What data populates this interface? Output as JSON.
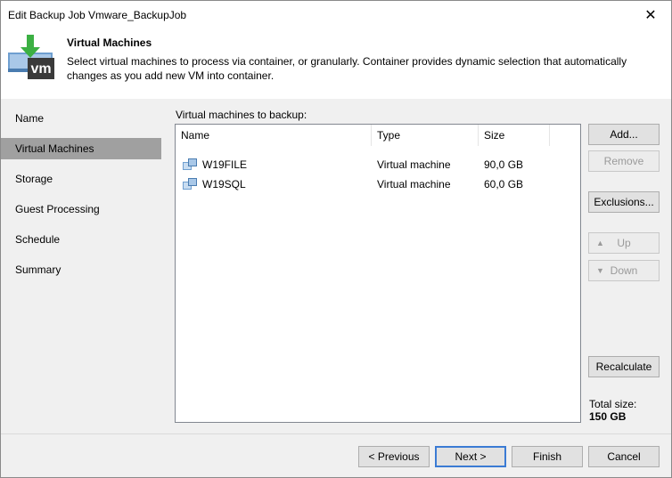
{
  "window": {
    "title": "Edit Backup Job Vmware_BackupJob",
    "close_glyph": "✕"
  },
  "header": {
    "title": "Virtual Machines",
    "description": "Select virtual machines to process via container, or granularly. Container provides dynamic selection that automatically changes as you add new VM into container.",
    "logo_text": "vm",
    "logo_icon": "vm-download-icon"
  },
  "nav": {
    "items": [
      {
        "label": "Name",
        "active": false
      },
      {
        "label": "Virtual Machines",
        "active": true
      },
      {
        "label": "Storage",
        "active": false
      },
      {
        "label": "Guest Processing",
        "active": false
      },
      {
        "label": "Schedule",
        "active": false
      },
      {
        "label": "Summary",
        "active": false
      }
    ]
  },
  "vm_list": {
    "label": "Virtual machines to backup:",
    "columns": [
      "Name",
      "Type",
      "Size"
    ],
    "rows": [
      {
        "name": "W19FILE",
        "type": "Virtual machine",
        "size": "90,0 GB",
        "icon": "vm-icon"
      },
      {
        "name": "W19SQL",
        "type": "Virtual machine",
        "size": "60,0 GB",
        "icon": "vm-icon"
      }
    ]
  },
  "side_buttons": {
    "add": "Add...",
    "remove": "Remove",
    "exclusions": "Exclusions...",
    "up": "Up",
    "down": "Down",
    "recalculate": "Recalculate"
  },
  "total": {
    "label": "Total size:",
    "value": "150 GB"
  },
  "footer": {
    "previous": "< Previous",
    "next": "Next >",
    "finish": "Finish",
    "cancel": "Cancel"
  },
  "colors": {
    "accent": "#3b7bd4",
    "nav_active": "#a0a0a0",
    "logo_green": "#3cb043",
    "logo_dark": "#3a3a3a"
  }
}
